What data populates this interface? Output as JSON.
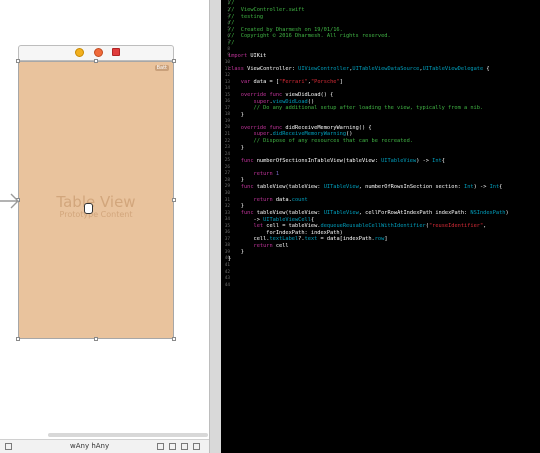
{
  "canvas": {
    "table_view_title": "Table View",
    "table_view_subtitle": "Prototype Content",
    "badge": "Batt",
    "size_class_label": "wAny hAny",
    "colors": {
      "scene_background": "#e9c39d",
      "scene_text": "#d2a67c"
    },
    "dock_icons": [
      "view-controller-icon",
      "first-responder-icon",
      "exit-icon"
    ]
  },
  "editor": {
    "colors": {
      "background": "#000000",
      "comment": "#41b645",
      "keyword": "#c2349b",
      "type": "#00a0be",
      "string": "#db2c38",
      "number": "#786dc4"
    },
    "line_numbers": [
      "1",
      "2",
      "3",
      "4",
      "5",
      "6",
      "7",
      "8",
      "9",
      "10",
      "11",
      "12",
      "13",
      "14",
      "15",
      "16",
      "17",
      "18",
      "19",
      "20",
      "21",
      "22",
      "23",
      "24",
      "25",
      "26",
      "27",
      "28",
      "29",
      "30",
      "31",
      "32",
      "33",
      "34",
      "35",
      "36",
      "37",
      "38",
      "39",
      "40",
      "41",
      "42",
      "43",
      "44"
    ],
    "lines": [
      [
        {
          "t": "//",
          "c": "comment"
        }
      ],
      [
        {
          "t": "//  ViewController.swift",
          "c": "comment"
        }
      ],
      [
        {
          "t": "//  testing",
          "c": "comment"
        }
      ],
      [
        {
          "t": "//",
          "c": "comment"
        }
      ],
      [
        {
          "t": "//  Created by Dharmesh on 19/01/16.",
          "c": "comment"
        }
      ],
      [
        {
          "t": "//  Copyright © 2016 Dharmesh. All rights reserved.",
          "c": "comment"
        }
      ],
      [
        {
          "t": "//",
          "c": "comment"
        }
      ],
      [],
      [
        {
          "t": "import",
          "c": "keyword"
        },
        {
          "t": " UIKit",
          "c": "plain"
        }
      ],
      [],
      [
        {
          "t": "class",
          "c": "keyword"
        },
        {
          "t": " ViewController: ",
          "c": "plain"
        },
        {
          "t": "UIViewController",
          "c": "type"
        },
        {
          "t": ",",
          "c": "plain"
        },
        {
          "t": "UITableViewDataSource",
          "c": "type"
        },
        {
          "t": ",",
          "c": "plain"
        },
        {
          "t": "UITableViewDelegate",
          "c": "type"
        },
        {
          "t": " {",
          "c": "plain"
        }
      ],
      [],
      [
        {
          "t": "    ",
          "c": "plain"
        },
        {
          "t": "var",
          "c": "keyword"
        },
        {
          "t": " data = [",
          "c": "plain"
        },
        {
          "t": "\"Ferrari\"",
          "c": "string"
        },
        {
          "t": ",",
          "c": "plain"
        },
        {
          "t": "\"Porsche\"",
          "c": "string"
        },
        {
          "t": "]",
          "c": "plain"
        }
      ],
      [],
      [
        {
          "t": "    ",
          "c": "plain"
        },
        {
          "t": "override func",
          "c": "keyword"
        },
        {
          "t": " viewDidLoad() {",
          "c": "plain"
        }
      ],
      [
        {
          "t": "        ",
          "c": "plain"
        },
        {
          "t": "super",
          "c": "keyword"
        },
        {
          "t": ".",
          "c": "plain"
        },
        {
          "t": "viewDidLoad",
          "c": "type"
        },
        {
          "t": "()",
          "c": "plain"
        }
      ],
      [
        {
          "t": "        // Do any additional setup after loading the view, typically from a nib.",
          "c": "comment"
        }
      ],
      [
        {
          "t": "    }",
          "c": "plain"
        }
      ],
      [],
      [
        {
          "t": "    ",
          "c": "plain"
        },
        {
          "t": "override func",
          "c": "keyword"
        },
        {
          "t": " didReceiveMemoryWarning() {",
          "c": "plain"
        }
      ],
      [
        {
          "t": "        ",
          "c": "plain"
        },
        {
          "t": "super",
          "c": "keyword"
        },
        {
          "t": ".",
          "c": "plain"
        },
        {
          "t": "didReceiveMemoryWarning",
          "c": "type"
        },
        {
          "t": "()",
          "c": "plain"
        }
      ],
      [
        {
          "t": "        // Dispose of any resources that can be recreated.",
          "c": "comment"
        }
      ],
      [
        {
          "t": "    }",
          "c": "plain"
        }
      ],
      [],
      [
        {
          "t": "    ",
          "c": "plain"
        },
        {
          "t": "func",
          "c": "keyword"
        },
        {
          "t": " numberOfSectionsInTableView(tableView: ",
          "c": "plain"
        },
        {
          "t": "UITableView",
          "c": "type"
        },
        {
          "t": ") -> ",
          "c": "plain"
        },
        {
          "t": "Int",
          "c": "type"
        },
        {
          "t": "{",
          "c": "plain"
        }
      ],
      [],
      [
        {
          "t": "        ",
          "c": "plain"
        },
        {
          "t": "return",
          "c": "keyword"
        },
        {
          "t": " ",
          "c": "plain"
        },
        {
          "t": "1",
          "c": "number"
        }
      ],
      [
        {
          "t": "    }",
          "c": "plain"
        }
      ],
      [
        {
          "t": "    ",
          "c": "plain"
        },
        {
          "t": "func",
          "c": "keyword"
        },
        {
          "t": " tableView(tableView: ",
          "c": "plain"
        },
        {
          "t": "UITableView",
          "c": "type"
        },
        {
          "t": ", numberOfRowsInSection section: ",
          "c": "plain"
        },
        {
          "t": "Int",
          "c": "type"
        },
        {
          "t": ") -> ",
          "c": "plain"
        },
        {
          "t": "Int",
          "c": "type"
        },
        {
          "t": "{",
          "c": "plain"
        }
      ],
      [],
      [
        {
          "t": "        ",
          "c": "plain"
        },
        {
          "t": "return",
          "c": "keyword"
        },
        {
          "t": " data.",
          "c": "plain"
        },
        {
          "t": "count",
          "c": "type"
        }
      ],
      [
        {
          "t": "    }",
          "c": "plain"
        }
      ],
      [
        {
          "t": "    ",
          "c": "plain"
        },
        {
          "t": "func",
          "c": "keyword"
        },
        {
          "t": " tableView(tableView: ",
          "c": "plain"
        },
        {
          "t": "UITableView",
          "c": "type"
        },
        {
          "t": ", cellForRowAtIndexPath indexPath: ",
          "c": "plain"
        },
        {
          "t": "NSIndexPath",
          "c": "type"
        },
        {
          "t": ")",
          "c": "plain"
        }
      ],
      [
        {
          "t": "        -> ",
          "c": "plain"
        },
        {
          "t": "UITableViewCell",
          "c": "type"
        },
        {
          "t": "{",
          "c": "plain"
        }
      ],
      [
        {
          "t": "        ",
          "c": "plain"
        },
        {
          "t": "let",
          "c": "keyword"
        },
        {
          "t": " cell = tableView.",
          "c": "plain"
        },
        {
          "t": "dequeueReusableCellWithIdentifier",
          "c": "type"
        },
        {
          "t": "(",
          "c": "plain"
        },
        {
          "t": "\"reuseIdentifier\"",
          "c": "string"
        },
        {
          "t": ",",
          "c": "plain"
        }
      ],
      [
        {
          "t": "            forIndexPath: indexPath)",
          "c": "plain"
        }
      ],
      [
        {
          "t": "        cell.",
          "c": "plain"
        },
        {
          "t": "textLabel",
          "c": "type"
        },
        {
          "t": "?.",
          "c": "plain"
        },
        {
          "t": "text",
          "c": "type"
        },
        {
          "t": " = data[indexPath.",
          "c": "plain"
        },
        {
          "t": "row",
          "c": "type"
        },
        {
          "t": "]",
          "c": "plain"
        }
      ],
      [
        {
          "t": "        ",
          "c": "plain"
        },
        {
          "t": "return",
          "c": "keyword"
        },
        {
          "t": " cell",
          "c": "plain"
        }
      ],
      [
        {
          "t": "    }",
          "c": "plain"
        }
      ],
      [
        {
          "t": "}",
          "c": "plain"
        }
      ],
      [],
      [],
      [],
      []
    ]
  }
}
